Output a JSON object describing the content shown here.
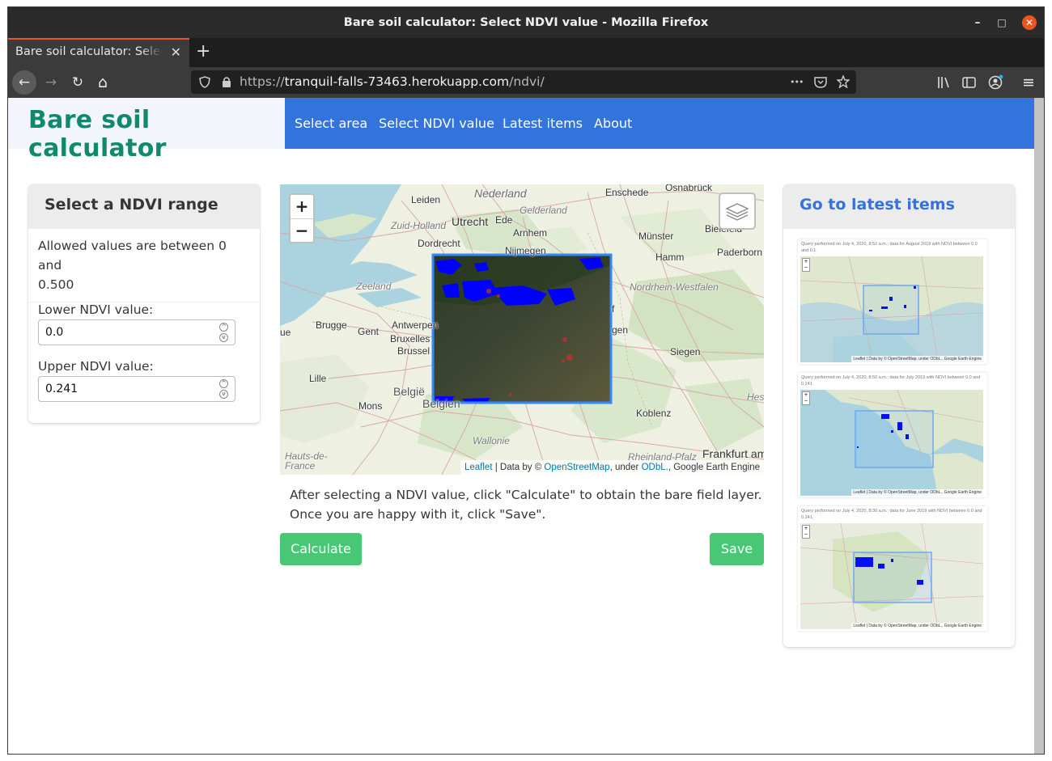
{
  "window": {
    "title": "Bare soil calculator: Select NDVI value - Mozilla Firefox",
    "controls": {
      "minimize": "–",
      "maximize": "□",
      "close": "✕"
    }
  },
  "tab": {
    "label": "Bare soil calculator: Select NDVI value",
    "close": "✕",
    "new_tab": "+"
  },
  "nav": {
    "back": "←",
    "forward": "→",
    "reload": "↻",
    "home": "⌂",
    "url_prefix": "https://",
    "url_host": "tranquil-falls-73463.herokuapp.com",
    "url_path": "/ndvi/",
    "more": "•••",
    "menu": "≡"
  },
  "site": {
    "brand": "Bare soil calculator",
    "menu": [
      "Select area",
      "Select NDVI value",
      "Latest items",
      "About"
    ]
  },
  "range_panel": {
    "title": "Select a NDVI range",
    "allowed": "Allowed values between 0 and 0.500",
    "allowed_line1": "Allowed values are between 0 and",
    "allowed_line2": "0.500",
    "lower_label": "Lower NDVI value:",
    "lower_value": "0.0",
    "upper_label": "Upper NDVI value:",
    "upper_value": "0.241"
  },
  "map": {
    "zoom_in": "+",
    "zoom_out": "−",
    "attribution": {
      "leaflet": "Leaflet",
      "data_by": " | Data by © ",
      "osm": "OpenStreetMap",
      "under": ", under ",
      "odbl": "ODbL.",
      "gee": ", Google Earth Engine"
    },
    "places": [
      "Nederland",
      "Gelderland",
      "Enschede",
      "Osnabrück",
      "Leiden",
      "Utrecht",
      "Ede",
      "Zuid-Holland",
      "Arnhem",
      "Bielefeld",
      "Münster",
      "Paderborn",
      "Dordrecht",
      "Nijmegen",
      "Hamm",
      "Zeeland",
      "Nordrhein-Westfalen",
      "Brugge",
      "Gent",
      "Antwerpen",
      "Bruxelles",
      "Brussel",
      "Siegen",
      "Lille",
      "België",
      "Belgien",
      "Mons",
      "Wallonie",
      "Koblenz",
      "Hess",
      "Hauts-de-France",
      "Rheinland-Pfalz",
      "Frankfurt am",
      "ue",
      "f",
      "gen"
    ]
  },
  "instructions": {
    "line1": "After selecting a NDVI value, click \"Calculate\" to obtain the bare field layer.",
    "line2": "Once you are happy with it, click \"Save\"."
  },
  "buttons": {
    "calculate": "Calculate",
    "save": "Save"
  },
  "latest": {
    "title": "Go to latest items",
    "items": [
      {
        "caption": "Query performed on July 4, 2020, 8:52 a.m.; data for August 2019 with NDVI between 0.0 and 0.1.",
        "attribution": "Leaflet | Data by © OpenStreetMap, under ODbL., Google Earth Engine"
      },
      {
        "caption": "Query performed on July 4, 2020, 8:50 a.m.; data for July 2019 with NDVI between 0.0 and 0.241.",
        "attribution": "Leaflet | Data by © OpenStreetMap, under ODbL., Google Earth Engine"
      },
      {
        "caption": "Query performed on July 4, 2020, 8:30 a.m.; data for June 2019 with NDVI between 0.0 and 0.241.",
        "attribution": "Leaflet | Data by © OpenStreetMap, under ODbL., Google Earth Engine"
      }
    ]
  },
  "colors": {
    "brand": "#0f8a6c",
    "navbar": "#3273dc",
    "button": "#48c774",
    "water": "#aad3df",
    "land": "#eef0e2"
  }
}
